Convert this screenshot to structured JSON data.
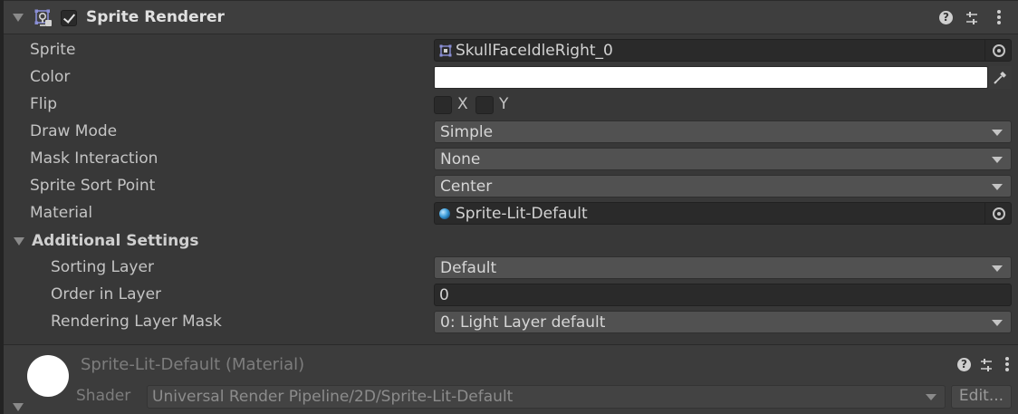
{
  "component": {
    "title": "Sprite Renderer",
    "enabled": true,
    "icons": [
      "sprite-renderer-icon",
      "help-icon",
      "presets-icon",
      "more-menu-icon"
    ]
  },
  "properties": {
    "sprite": {
      "label": "Sprite",
      "value": "SkullFaceIdleRight_0",
      "icon": "sprite-asset-icon"
    },
    "color": {
      "label": "Color",
      "value": "#ffffff"
    },
    "flip": {
      "label": "Flip",
      "x_label": "X",
      "y_label": "Y",
      "x": false,
      "y": false
    },
    "draw_mode": {
      "label": "Draw Mode",
      "value": "Simple"
    },
    "mask_interaction": {
      "label": "Mask Interaction",
      "value": "None"
    },
    "sprite_sort_point": {
      "label": "Sprite Sort Point",
      "value": "Center"
    },
    "material": {
      "label": "Material",
      "value": "Sprite-Lit-Default",
      "icon": "material-sphere-icon"
    }
  },
  "additional_settings": {
    "title": "Additional Settings",
    "sorting_layer": {
      "label": "Sorting Layer",
      "value": "Default"
    },
    "order_in_layer": {
      "label": "Order in Layer",
      "value": "0"
    },
    "rendering_layer_mask": {
      "label": "Rendering Layer Mask",
      "value": "0: Light Layer default"
    }
  },
  "material_section": {
    "title": "Sprite-Lit-Default (Material)",
    "shader_label": "Shader",
    "shader_value": "Universal Render Pipeline/2D/Sprite-Lit-Default",
    "edit_label": "Edit..."
  },
  "colors": {
    "panel_bg": "#383838",
    "header_bg": "#3e3e3e",
    "field_bg": "#2a2a2a",
    "dropdown_bg": "#515151",
    "text": "#c4c4c4"
  }
}
